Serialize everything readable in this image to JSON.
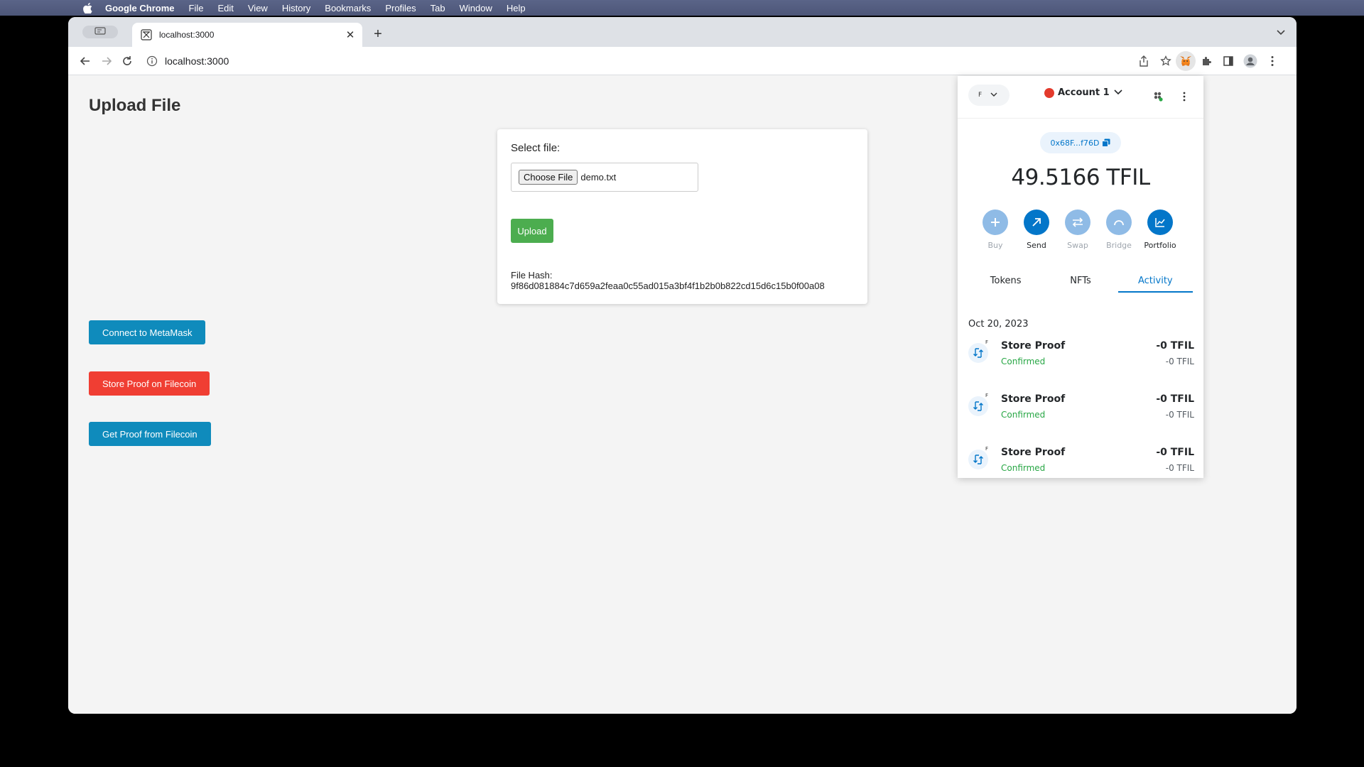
{
  "menubar": {
    "app": "Google Chrome",
    "items": [
      "File",
      "Edit",
      "View",
      "History",
      "Bookmarks",
      "Profiles",
      "Tab",
      "Window",
      "Help"
    ]
  },
  "browser": {
    "tab_title": "localhost:3000",
    "url": "localhost:3000"
  },
  "page": {
    "title": "Upload File",
    "select_label": "Select file:",
    "choose_button": "Choose File",
    "file_name": "demo.txt",
    "upload_button": "Upload",
    "hash_label": "File Hash:",
    "hash_value": "9f86d081884c7d659a2feaa0c55ad015a3bf4f1b2b0b822cd15d6c15b0f00a08",
    "connect_button": "Connect to MetaMask",
    "store_button": "Store Proof on Filecoin",
    "get_button": "Get Proof from Filecoin"
  },
  "metamask": {
    "network_initial": "F",
    "account": "Account 1",
    "address": "0x68F...f76D",
    "balance": "49.5166 TFIL",
    "actions": [
      {
        "label": "Buy",
        "enabled": false
      },
      {
        "label": "Send",
        "enabled": true
      },
      {
        "label": "Swap",
        "enabled": false
      },
      {
        "label": "Bridge",
        "enabled": false
      },
      {
        "label": "Portfolio",
        "enabled": true
      }
    ],
    "tabs": [
      "Tokens",
      "NFTs",
      "Activity"
    ],
    "active_tab": "Activity",
    "date": "Oct 20, 2023",
    "transactions": [
      {
        "title": "Store Proof",
        "status": "Confirmed",
        "amount": "-0 TFIL",
        "sub_amount": "-0 TFIL",
        "badge": "F"
      },
      {
        "title": "Store Proof",
        "status": "Confirmed",
        "amount": "-0 TFIL",
        "sub_amount": "-0 TFIL",
        "badge": "F"
      },
      {
        "title": "Store Proof",
        "status": "Confirmed",
        "amount": "-0 TFIL",
        "sub_amount": "-0 TFIL",
        "badge": "F"
      }
    ]
  },
  "colors": {
    "metamask_accent": "#0376c9",
    "confirmed": "#28a745",
    "button_blue": "#0f8bbc",
    "button_red": "#f03e33",
    "upload_green": "#4cad4f"
  }
}
